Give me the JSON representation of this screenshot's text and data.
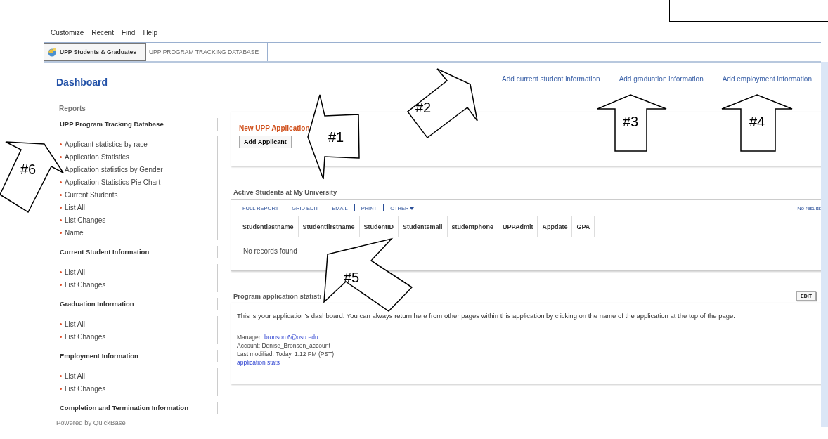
{
  "menu": [
    "Customize",
    "Recent",
    "Find",
    "Help"
  ],
  "tabs": [
    {
      "label": "UPP Students & Graduates",
      "kind": "app",
      "selected": true
    },
    {
      "label": "UPP PROGRAM TRACKING DATABASE",
      "kind": "table",
      "selected": false
    }
  ],
  "page_title": "Dashboard",
  "sidebar": {
    "heading": "Reports",
    "groups": [
      {
        "title": "UPP Program Tracking Database",
        "items": [
          "Applicant statistics by race",
          "Application Statistics",
          "Application statistics by Gender",
          "Application Statistics Pie Chart",
          "Current Students",
          "List All",
          "List Changes",
          "Name"
        ]
      },
      {
        "title": "Current Student Information",
        "items": [
          "List All",
          "List Changes"
        ]
      },
      {
        "title": "Graduation Information",
        "items": [
          "List All",
          "List Changes"
        ]
      },
      {
        "title": "Employment Information",
        "items": [
          "List All",
          "List Changes"
        ]
      },
      {
        "title": "Completion and Termination Information"
      }
    ],
    "footer": "Powered by QuickBase"
  },
  "quick_links": [
    "Add current student information",
    "Add graduation information",
    "Add employment information"
  ],
  "new_application": {
    "title": "New UPP Application",
    "button": "Add Applicant"
  },
  "active_students": {
    "title": "Active Students at My University",
    "toolbar": [
      "FULL REPORT",
      "GRID EDIT",
      "EMAIL",
      "PRINT",
      "OTHER"
    ],
    "result_count": "No results",
    "columns": [
      "Studentlastname",
      "Studentfirstname",
      "StudentID",
      "Studentemail",
      "studentphone",
      "UPPAdmit",
      "Appdate",
      "GPA"
    ],
    "empty_message": "No records found"
  },
  "program_stats": {
    "title": "Program application statisti",
    "edit_button": "EDIT",
    "description": "This is your application's dashboard.  You can always return here from other pages within this application by clicking on the name of the application at the top of the page.",
    "manager_label": "Manager:",
    "manager_email": "bronson.6@osu.edu",
    "account": "Account: Denise_Bronson_account",
    "modified": "Last modified: Today, 1:12 PM (PST)",
    "link": "application stats"
  },
  "annotations": [
    {
      "label": "#1"
    },
    {
      "label": "#2"
    },
    {
      "label": "#3"
    },
    {
      "label": "#4"
    },
    {
      "label": "#5"
    },
    {
      "label": "#6"
    }
  ]
}
